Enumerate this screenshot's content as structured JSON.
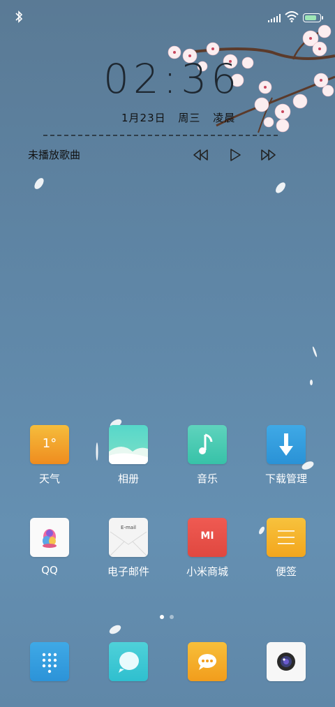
{
  "status_bar": {
    "bluetooth_icon": "bluetooth-icon",
    "signal_icon": "signal-icon",
    "wifi_icon": "wifi-icon",
    "battery_level": 0.8
  },
  "lockscreen": {
    "time": "02:36",
    "date": "1月23日",
    "weekday": "周三",
    "period": "凌晨"
  },
  "music": {
    "status": "未播放歌曲",
    "controls": [
      "rewind-icon",
      "play-icon",
      "fast-forward-icon"
    ]
  },
  "apps_row1": [
    {
      "label": "天气",
      "icon_text": "1°",
      "color_top": "#f3b43a",
      "color_bottom": "#f08b1e"
    },
    {
      "label": "相册"
    },
    {
      "label": "音乐"
    },
    {
      "label": "下载管理"
    }
  ],
  "apps_row2": [
    {
      "label": "QQ"
    },
    {
      "label": "电子邮件",
      "icon_text": "E-mail"
    },
    {
      "label": "小米商城",
      "icon_text": "MI"
    },
    {
      "label": "便签"
    }
  ],
  "page_indicator": {
    "pages": 2,
    "current": 1
  },
  "dock": [
    "phone-icon",
    "messages-icon",
    "chat-icon",
    "camera-icon"
  ]
}
